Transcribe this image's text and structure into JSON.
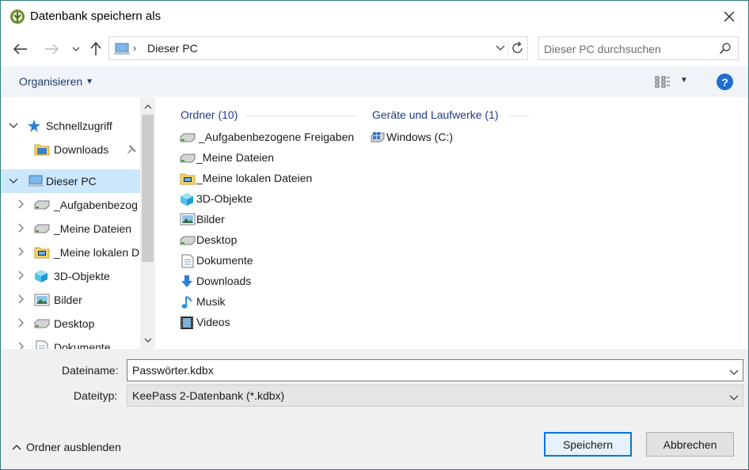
{
  "window": {
    "title": "Datenbank speichern als",
    "close_icon": "close-icon"
  },
  "navigation": {
    "address_text": "Dieser PC",
    "search_placeholder": "Dieser PC durchsuchen"
  },
  "commandbar": {
    "organize_label": "Organisieren",
    "help_label": "?"
  },
  "navpane": {
    "items": [
      {
        "label": "Schnellzugriff",
        "icon": "star-icon",
        "expander": "expanded"
      },
      {
        "label": "Downloads",
        "icon": "folder-icon",
        "pinned": true
      },
      {
        "label": "Dieser PC",
        "icon": "computer-icon",
        "expander": "expanded",
        "selected": true
      },
      {
        "label": "_Aufgabenbezog",
        "icon": "network-drive-icon",
        "expander": "collapsed"
      },
      {
        "label": "_Meine Dateien",
        "icon": "network-drive-icon",
        "expander": "collapsed"
      },
      {
        "label": "_Meine lokalen D",
        "icon": "folder-computer-icon",
        "expander": "collapsed"
      },
      {
        "label": "3D-Objekte",
        "icon": "cube-icon",
        "expander": "collapsed"
      },
      {
        "label": "Bilder",
        "icon": "pictures-icon",
        "expander": "collapsed"
      },
      {
        "label": "Desktop",
        "icon": "network-drive-icon",
        "expander": "collapsed"
      },
      {
        "label": "Dokumente",
        "icon": "document-icon",
        "expander": "collapsed"
      }
    ]
  },
  "content": {
    "folders_header": "Ordner (10)",
    "devices_header": "Geräte und Laufwerke (1)",
    "folders": [
      {
        "label": "_Aufgabenbezogene Freigaben",
        "icon": "network-drive-icon"
      },
      {
        "label": "_Meine Dateien",
        "icon": "network-drive-icon"
      },
      {
        "label": "_Meine lokalen Dateien",
        "icon": "folder-computer-icon"
      },
      {
        "label": "3D-Objekte",
        "icon": "cube-icon"
      },
      {
        "label": "Bilder",
        "icon": "pictures-icon"
      },
      {
        "label": "Desktop",
        "icon": "network-drive-icon"
      },
      {
        "label": "Dokumente",
        "icon": "document-icon"
      },
      {
        "label": "Downloads",
        "icon": "download-arrow-icon"
      },
      {
        "label": "Musik",
        "icon": "music-note-icon"
      },
      {
        "label": "Videos",
        "icon": "film-icon"
      }
    ],
    "devices": [
      {
        "label": "Windows (C:)",
        "icon": "windows-drive-icon"
      }
    ]
  },
  "form": {
    "filename_label": "Dateiname:",
    "filename_value": "Passwörter.kdbx",
    "filetype_label": "Dateityp:",
    "filetype_value": "KeePass 2-Datenbank (*.kdbx)",
    "hide_folders_label": "Ordner ausblenden",
    "save_label": "Speichern",
    "cancel_label": "Abbrechen"
  },
  "colors": {
    "accent": "#0078d7",
    "selection": "#cce8ff",
    "header_blue": "#1e3a8a"
  }
}
